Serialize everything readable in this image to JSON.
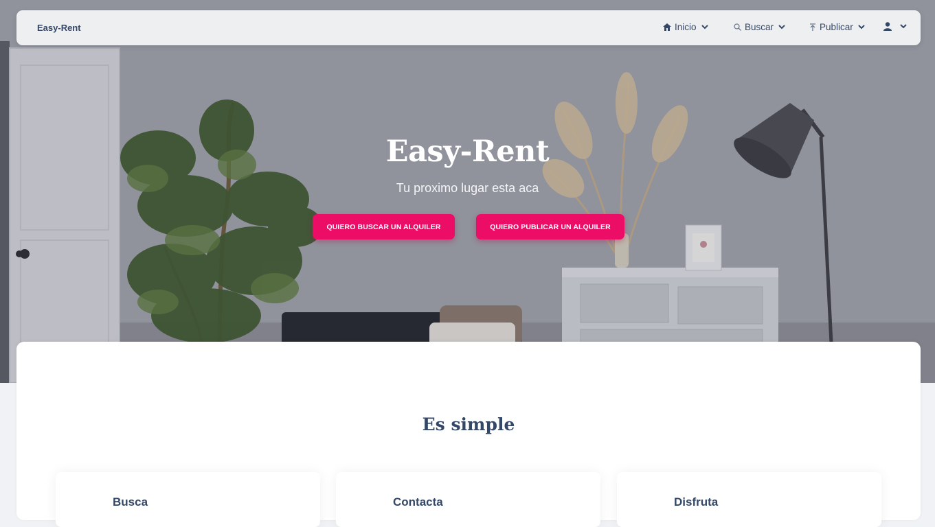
{
  "navbar": {
    "brand": "Easy-Rent",
    "items": [
      {
        "label": "Inicio",
        "icon": "home-icon"
      },
      {
        "label": "Buscar",
        "icon": "search-icon"
      },
      {
        "label": "Publicar",
        "icon": "upload-icon"
      },
      {
        "label": "",
        "icon": "user-icon"
      }
    ]
  },
  "hero": {
    "title": "Easy-Rent",
    "subtitle": "Tu proximo lugar esta aca",
    "buttons": [
      {
        "label": "QUIERO BUSCAR UN ALQUILER"
      },
      {
        "label": "QUIERO PUBLICAR UN ALQUILER"
      }
    ]
  },
  "section": {
    "title": "Es simple",
    "features": [
      {
        "title": "Busca"
      },
      {
        "title": "Contacta"
      },
      {
        "title": "Disfruta"
      }
    ]
  },
  "colors": {
    "primary_button": "#eb0d66",
    "text_dark": "#344767",
    "navbar_bg": "#f5f6f8"
  }
}
